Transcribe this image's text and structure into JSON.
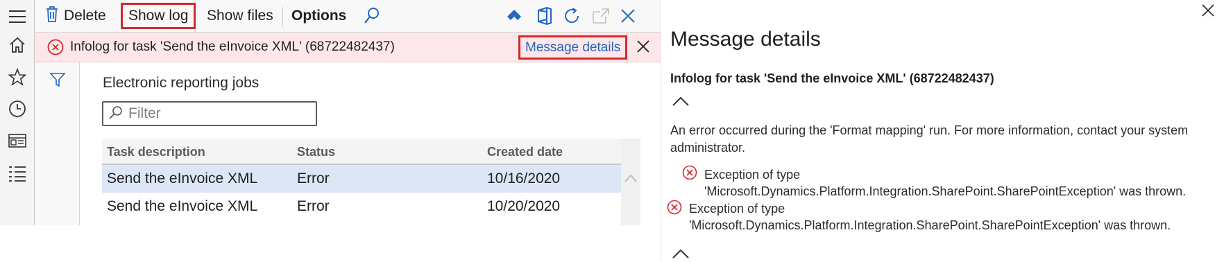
{
  "toolbar": {
    "delete_label": "Delete",
    "show_log_label": "Show log",
    "show_files_label": "Show files",
    "options_label": "Options"
  },
  "message_bar": {
    "text": "Infolog for task 'Send the eInvoice XML' (68722482437)",
    "link_label": "Message details"
  },
  "page": {
    "title": "Electronic reporting jobs",
    "filter_placeholder": "Filter"
  },
  "grid": {
    "headers": [
      "Task description",
      "Status",
      "Created date"
    ],
    "rows": [
      [
        "Send the eInvoice XML",
        "Error",
        "10/16/2020"
      ],
      [
        "Send the eInvoice XML",
        "Error",
        "10/20/2020"
      ]
    ]
  },
  "details": {
    "title": "Message details",
    "subtitle": "Infolog for task 'Send the eInvoice XML' (68722482437)",
    "message": "An error occurred during the 'Format mapping' run. For more information, contact your system administrator.",
    "exceptions": [
      {
        "line1": "Exception of type",
        "line2": "'Microsoft.Dynamics.Platform.Integration.SharePoint.SharePointException' was thrown."
      },
      {
        "line1": "Exception of type",
        "line2": "'Microsoft.Dynamics.Platform.Integration.SharePoint.SharePointException' was thrown."
      }
    ]
  },
  "icons": {
    "nav": [
      "hamburger-icon",
      "home-icon",
      "star-icon",
      "clock-icon",
      "workspace-icon",
      "list-icon"
    ],
    "toolbar_right": [
      "connected-icon",
      "office-icon",
      "refresh-icon",
      "open-new-window-icon",
      "close-icon"
    ]
  },
  "colors": {
    "accent": "#2266c0",
    "error": "#d4272e",
    "error_bar_bg": "#fde7e9",
    "selected_row": "#dce6f7",
    "highlight_border": "#d4272e"
  }
}
